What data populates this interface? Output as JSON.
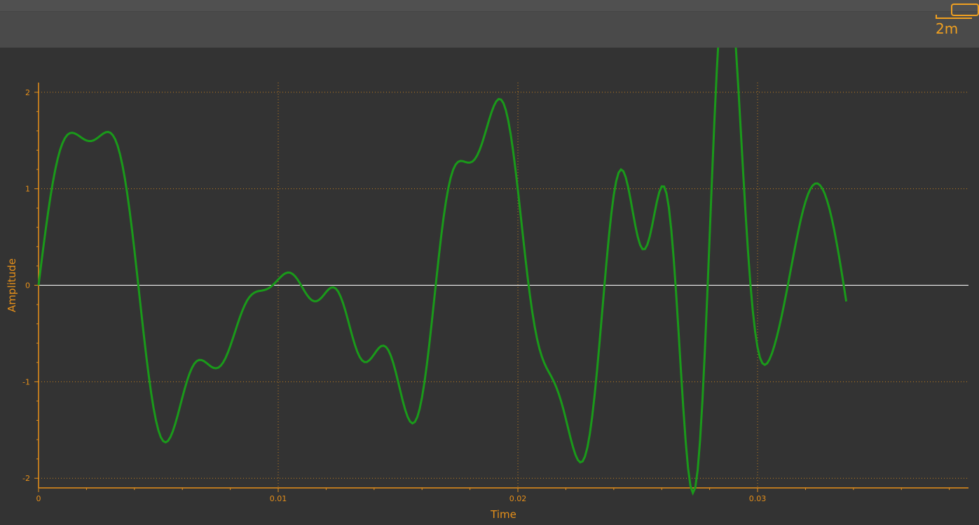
{
  "toolbar": {
    "scale_label": "2m"
  },
  "chart_data": {
    "type": "line",
    "title": "",
    "xlabel": "Time",
    "ylabel": "Amplitude",
    "xlim": [
      0,
      0.0388
    ],
    "ylim": [
      -2.1,
      2.1
    ],
    "x_ticks": [
      0,
      0.01,
      0.02,
      0.03
    ],
    "x_tick_labels": [
      "0",
      "0.01",
      "0.02",
      "0.03"
    ],
    "y_ticks": [
      2,
      1,
      0,
      -1,
      -2
    ],
    "y_tick_labels": [
      "2",
      "1",
      "0",
      "-1",
      "-2"
    ],
    "grid": true,
    "series": [
      {
        "color": "#1a9a1a",
        "sampling_interval": 0.0001,
        "y": [
          0.0,
          0.198,
          0.392,
          0.58,
          0.758,
          0.922,
          1.07,
          1.201,
          1.312,
          1.403,
          1.473,
          1.524,
          1.558,
          1.576,
          1.58,
          1.575,
          1.562,
          1.546,
          1.528,
          1.512,
          1.5,
          1.494,
          1.494,
          1.502,
          1.516,
          1.534,
          1.554,
          1.572,
          1.585,
          1.589,
          1.58,
          1.555,
          1.511,
          1.446,
          1.357,
          1.245,
          1.109,
          0.951,
          0.772,
          0.575,
          0.364,
          0.142,
          -0.084,
          -0.31,
          -0.532,
          -0.744,
          -0.94,
          -1.118,
          -1.273,
          -1.402,
          -1.503,
          -1.574,
          -1.615,
          -1.628,
          -1.613,
          -1.574,
          -1.515,
          -1.439,
          -1.352,
          -1.258,
          -1.163,
          -1.072,
          -0.988,
          -0.915,
          -0.856,
          -0.813,
          -0.786,
          -0.774,
          -0.775,
          -0.786,
          -0.804,
          -0.824,
          -0.843,
          -0.856,
          -0.86,
          -0.854,
          -0.834,
          -0.801,
          -0.755,
          -0.697,
          -0.63,
          -0.557,
          -0.481,
          -0.405,
          -0.332,
          -0.266,
          -0.208,
          -0.159,
          -0.122,
          -0.095,
          -0.077,
          -0.066,
          -0.06,
          -0.056,
          -0.051,
          -0.043,
          -0.031,
          -0.014,
          0.008,
          0.033,
          0.06,
          0.085,
          0.108,
          0.124,
          0.132,
          0.13,
          0.117,
          0.094,
          0.062,
          0.023,
          -0.019,
          -0.062,
          -0.1,
          -0.132,
          -0.155,
          -0.166,
          -0.165,
          -0.152,
          -0.13,
          -0.101,
          -0.07,
          -0.043,
          -0.025,
          -0.021,
          -0.034,
          -0.065,
          -0.116,
          -0.182,
          -0.262,
          -0.351,
          -0.444,
          -0.535,
          -0.618,
          -0.689,
          -0.743,
          -0.779,
          -0.796,
          -0.795,
          -0.778,
          -0.75,
          -0.716,
          -0.68,
          -0.65,
          -0.63,
          -0.626,
          -0.64,
          -0.675,
          -0.731,
          -0.806,
          -0.896,
          -0.997,
          -1.101,
          -1.202,
          -1.292,
          -1.364,
          -1.412,
          -1.431,
          -1.417,
          -1.368,
          -1.282,
          -1.161,
          -1.008,
          -0.826,
          -0.621,
          -0.399,
          -0.167,
          0.067,
          0.295,
          0.509,
          0.703,
          0.871,
          1.01,
          1.119,
          1.198,
          1.25,
          1.278,
          1.288,
          1.286,
          1.278,
          1.271,
          1.271,
          1.281,
          1.305,
          1.345,
          1.4,
          1.468,
          1.547,
          1.631,
          1.715,
          1.793,
          1.859,
          1.907,
          1.93,
          1.924,
          1.886,
          1.812,
          1.704,
          1.563,
          1.393,
          1.199,
          0.986,
          0.762,
          0.534,
          0.31,
          0.096,
          -0.1,
          -0.276,
          -0.428,
          -0.555,
          -0.658,
          -0.74,
          -0.805,
          -0.858,
          -0.904,
          -0.949,
          -0.998,
          -1.055,
          -1.122,
          -1.2,
          -1.288,
          -1.385,
          -1.486,
          -1.586,
          -1.678,
          -1.755,
          -1.81,
          -1.835,
          -1.825,
          -1.774,
          -1.68,
          -1.542,
          -1.361,
          -1.141,
          -0.889,
          -0.614,
          -0.325,
          -0.034,
          0.249,
          0.512,
          0.744,
          0.935,
          1.077,
          1.166,
          1.2,
          1.182,
          1.118,
          1.017,
          0.89,
          0.752,
          0.618,
          0.502,
          0.418,
          0.374,
          0.375,
          0.42,
          0.504,
          0.617,
          0.744,
          0.867,
          0.967,
          1.024,
          1.023,
          0.951,
          0.802,
          0.575,
          0.277,
          -0.078,
          -0.47,
          -0.876,
          -1.268,
          -1.618,
          -1.897,
          -2.081,
          -2.152,
          -2.099,
          -1.917,
          -1.611,
          -1.194,
          -0.685,
          -0.109,
          0.503,
          1.12,
          1.707,
          2.232,
          2.669,
          2.996,
          3.2,
          3.275,
          3.224,
          3.056,
          2.788,
          2.44,
          2.037,
          1.603,
          1.164,
          0.742,
          0.355,
          0.017,
          -0.264,
          -0.484,
          -0.645,
          -0.751,
          -0.808,
          -0.825,
          -0.809,
          -0.767,
          -0.706,
          -0.628,
          -0.538,
          -0.436,
          -0.325,
          -0.206,
          -0.081,
          0.049,
          0.181,
          0.312,
          0.441,
          0.563,
          0.677,
          0.779,
          0.867,
          0.94,
          0.996,
          1.034,
          1.054,
          1.055,
          1.038,
          1.003,
          0.95,
          0.879,
          0.792,
          0.688,
          0.57,
          0.439,
          0.298,
          0.148,
          -0.008,
          -0.168
        ]
      }
    ]
  }
}
